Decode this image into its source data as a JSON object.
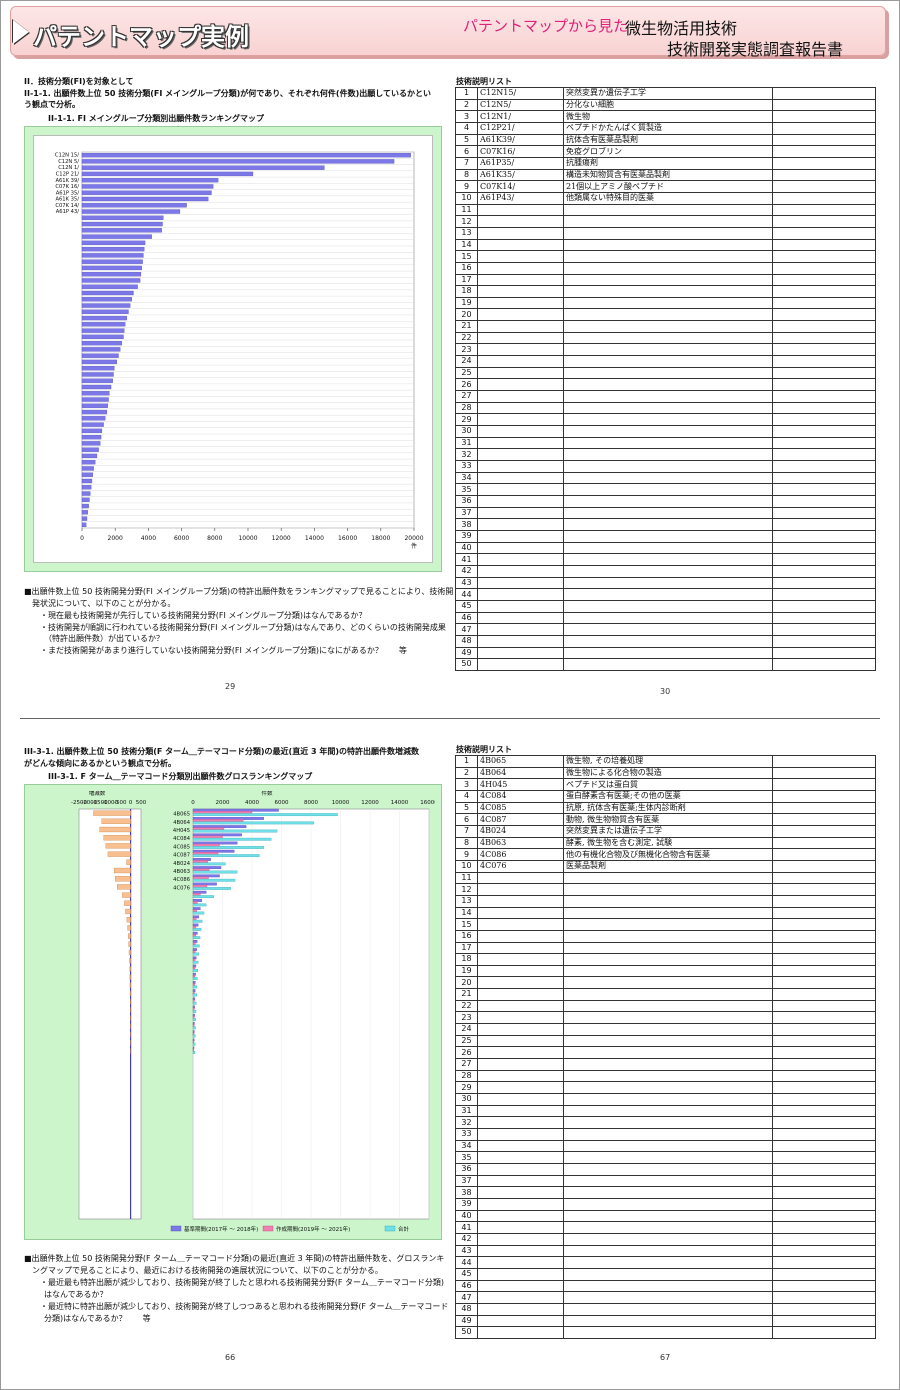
{
  "header": {
    "title": "パテントマップ実例",
    "subtitle": "パテントマップから見た",
    "report_line1": "微生物活用技術",
    "report_line2": "技術開発実態調査報告書"
  },
  "section1": {
    "heading1": "II．技術分類(FI)を対象として",
    "heading2a": "II-1-1. 出願件数上位 50 技術分類(FI メイングループ分類)が何であり、それぞれ何件(件数)出願しているかとい",
    "heading2b": "う観点で分析。",
    "chart_title": "II-1-1. FI メイングループ分類別出願件数ランキングマップ",
    "note1": "■出願件数上位 50 技術開発分野(FI メイングループ分類)の特許出願件数をランキングマップで見ることにより、技術開",
    "note2": "発状況について、以下のことが分かる。",
    "note3": "・現在最も技術開発が先行している技術開発分野(FI メイングループ分類)はなんであるか？",
    "note4": "・技術開発が順調に行われている技術開発分野(FI メイングループ分類)はなんであり、どのくらいの技術開発成果",
    "note5": "（特許出願件数）が出ているか？",
    "note6": "・まだ技術開発があまり進行していない技術開発分野(FI メイングループ分類)になにがあるか？　　等",
    "page_left": "29",
    "page_right": "30",
    "table_title": "技術説明リスト",
    "x_unit": "件"
  },
  "section2": {
    "heading1a": "III-3-1. 出願件数上位 50 技術分類(F ターム＿テーマコード分類)の最近(直近 3 年間)の特許出願件数増減数",
    "heading1b": "がどんな傾向にあるかという観点で分析。",
    "chart_title": "III-3-1. F ターム＿テーマコード分類別出願件数グロスランキングマップ",
    "left_axis_label": "増減数",
    "right_axis_label": "件数",
    "legend1": "基準期間(2017年 ～ 2018年)",
    "legend2": "作成期間(2019年 ～ 2021年)",
    "legend3": "合計",
    "note1": "■出願件数上位 50 技術開発分野(F ターム＿テーマコード分類)の最近(直近 3 年間)の特許出願件数を、グロスランキ",
    "note2": "ングマップで見ることにより、最近における技術開発の進展状況について、以下のことが分かる。",
    "note3": "・最近最も特許出願が減少しており、技術開発が終了したと思われる技術開発分野(F ターム＿テーマコード分類)",
    "note4": "はなんであるか？",
    "note5": "・最近特に特許出願が減少しており、技術開発が終了しつつあると思われる技術開発分野(F ターム＿テーマコード",
    "note6": "分類)はなんであるか？　　等",
    "page_left": "66",
    "page_right": "67",
    "table_title": "技術説明リスト"
  },
  "table1": [
    {
      "code": "C12N15/",
      "desc": "突然変異か遺伝子工学"
    },
    {
      "code": "C12N5/",
      "desc": "分化ない細胞"
    },
    {
      "code": "C12N1/",
      "desc": "微生物"
    },
    {
      "code": "C12P21/",
      "desc": "ペプチドかたんぱく質製造"
    },
    {
      "code": "A61K39/",
      "desc": "抗体含有医薬品製剤"
    },
    {
      "code": "C07K16/",
      "desc": "免疫グロブリン"
    },
    {
      "code": "A61P35/",
      "desc": "抗腫瘍剤"
    },
    {
      "code": "A61K35/",
      "desc": "構造未知物質含有医薬品製剤"
    },
    {
      "code": "C07K14/",
      "desc": "21個以上アミノ酸ペプチド"
    },
    {
      "code": "A61P43/",
      "desc": "他類属ない特殊目的医薬"
    }
  ],
  "table2": [
    {
      "code": "4B065",
      "desc": "微生物, その培養処理"
    },
    {
      "code": "4B064",
      "desc": "微生物による化合物の製造"
    },
    {
      "code": "4H045",
      "desc": "ペプチド又は蛋白質"
    },
    {
      "code": "4C084",
      "desc": "蛋白酵素含有医薬;その他の医薬"
    },
    {
      "code": "4C085",
      "desc": "抗原, 抗体含有医薬;生体内診断剤"
    },
    {
      "code": "4C087",
      "desc": "動物, 微生物物質含有医薬"
    },
    {
      "code": "4B024",
      "desc": "突然変異または遺伝子工学"
    },
    {
      "code": "4B063",
      "desc": "酵素, 微生物を含む測定, 試験"
    },
    {
      "code": "4C086",
      "desc": "他の有機化合物及び無機化合物含有医薬"
    },
    {
      "code": "4C076",
      "desc": "医薬品製剤"
    }
  ],
  "chart_data": [
    {
      "type": "bar",
      "title": "II-1-1. FI メイングループ分類別出願件数ランキングマップ",
      "orientation": "horizontal",
      "xlim": [
        0,
        20000
      ],
      "x_ticks": [
        0,
        2000,
        4000,
        6000,
        8000,
        10000,
        12000,
        14000,
        16000,
        18000,
        20000
      ],
      "x_unit": "件",
      "categories": [
        "C12N 15/",
        "C12N 5/",
        "C12N 1/",
        "C12P 21/",
        "A61K 39/",
        "C07K 16/",
        "A61P 35/",
        "A61K 35/",
        "C07K 14/",
        "A61P 43/"
      ],
      "values": [
        19800,
        18800,
        14600,
        10300,
        8200,
        7900,
        7800,
        7600,
        6300,
        5900,
        4900,
        4850,
        4800,
        4200,
        3800,
        3750,
        3700,
        3650,
        3600,
        3550,
        3500,
        3350,
        3100,
        3000,
        2900,
        2800,
        2700,
        2600,
        2550,
        2500,
        2400,
        2300,
        2200,
        2100,
        1950,
        1900,
        1850,
        1750,
        1650,
        1600,
        1550,
        1500,
        1400,
        1300,
        1200,
        1150,
        1100,
        1000,
        900,
        800,
        700,
        650,
        600,
        550,
        500,
        450,
        400,
        350,
        300,
        250
      ]
    },
    {
      "type": "bar",
      "title": "III-3-1. F ターム＿テーマコード分類別出願件数グロスランキングマップ",
      "orientation": "horizontal",
      "left_panel": {
        "xlim": [
          -2500,
          500
        ],
        "x_ticks": [
          -2500,
          -2000,
          -1500,
          -1000,
          -500,
          0,
          500
        ],
        "label": "増減数"
      },
      "right_panel": {
        "xlim": [
          0,
          16000
        ],
        "x_ticks": [
          0,
          2000,
          4000,
          6000,
          8000,
          10000,
          12000,
          14000,
          16000
        ],
        "label": "件数"
      },
      "categories": [
        "4B065",
        "4B064",
        "4H045",
        "4C084",
        "4C085",
        "4C087",
        "4B024",
        "4B063",
        "4C086",
        "4C076"
      ],
      "change": [
        -1800,
        -1400,
        -1500,
        -1300,
        -1200,
        -1100,
        -200,
        -800,
        -750,
        -650,
        -400,
        -300,
        -250,
        -180,
        -150,
        -120,
        -100,
        -80,
        -60,
        -50,
        -40,
        -35,
        -30,
        -25,
        -20,
        -18,
        -15,
        -12,
        -10,
        -8
      ],
      "series": [
        {
          "name": "基準期間(2017年 ～ 2018年)",
          "values": [
            5800,
            4800,
            3600,
            3300,
            3000,
            2800,
            1200,
            1900,
            1800,
            1600,
            900,
            600,
            500,
            400,
            350,
            300,
            280,
            250,
            220,
            200,
            180,
            160,
            150,
            130,
            120,
            110,
            100,
            90,
            80,
            70
          ]
        },
        {
          "name": "作成期間(2019年 ～ 2021年)",
          "values": [
            4000,
            3400,
            2100,
            2000,
            1800,
            1700,
            1000,
            1100,
            1050,
            950,
            500,
            300,
            250,
            220,
            200,
            180,
            160,
            150,
            140,
            130,
            120,
            110,
            100,
            90,
            85,
            80,
            75,
            70,
            65,
            60
          ]
        },
        {
          "name": "合計",
          "values": [
            9800,
            8200,
            5700,
            5300,
            4800,
            4500,
            2200,
            3000,
            2850,
            2550,
            1400,
            900,
            750,
            620,
            550,
            480,
            440,
            400,
            360,
            330,
            300,
            270,
            250,
            220,
            205,
            190,
            175,
            160,
            145,
            130
          ]
        }
      ]
    }
  ]
}
